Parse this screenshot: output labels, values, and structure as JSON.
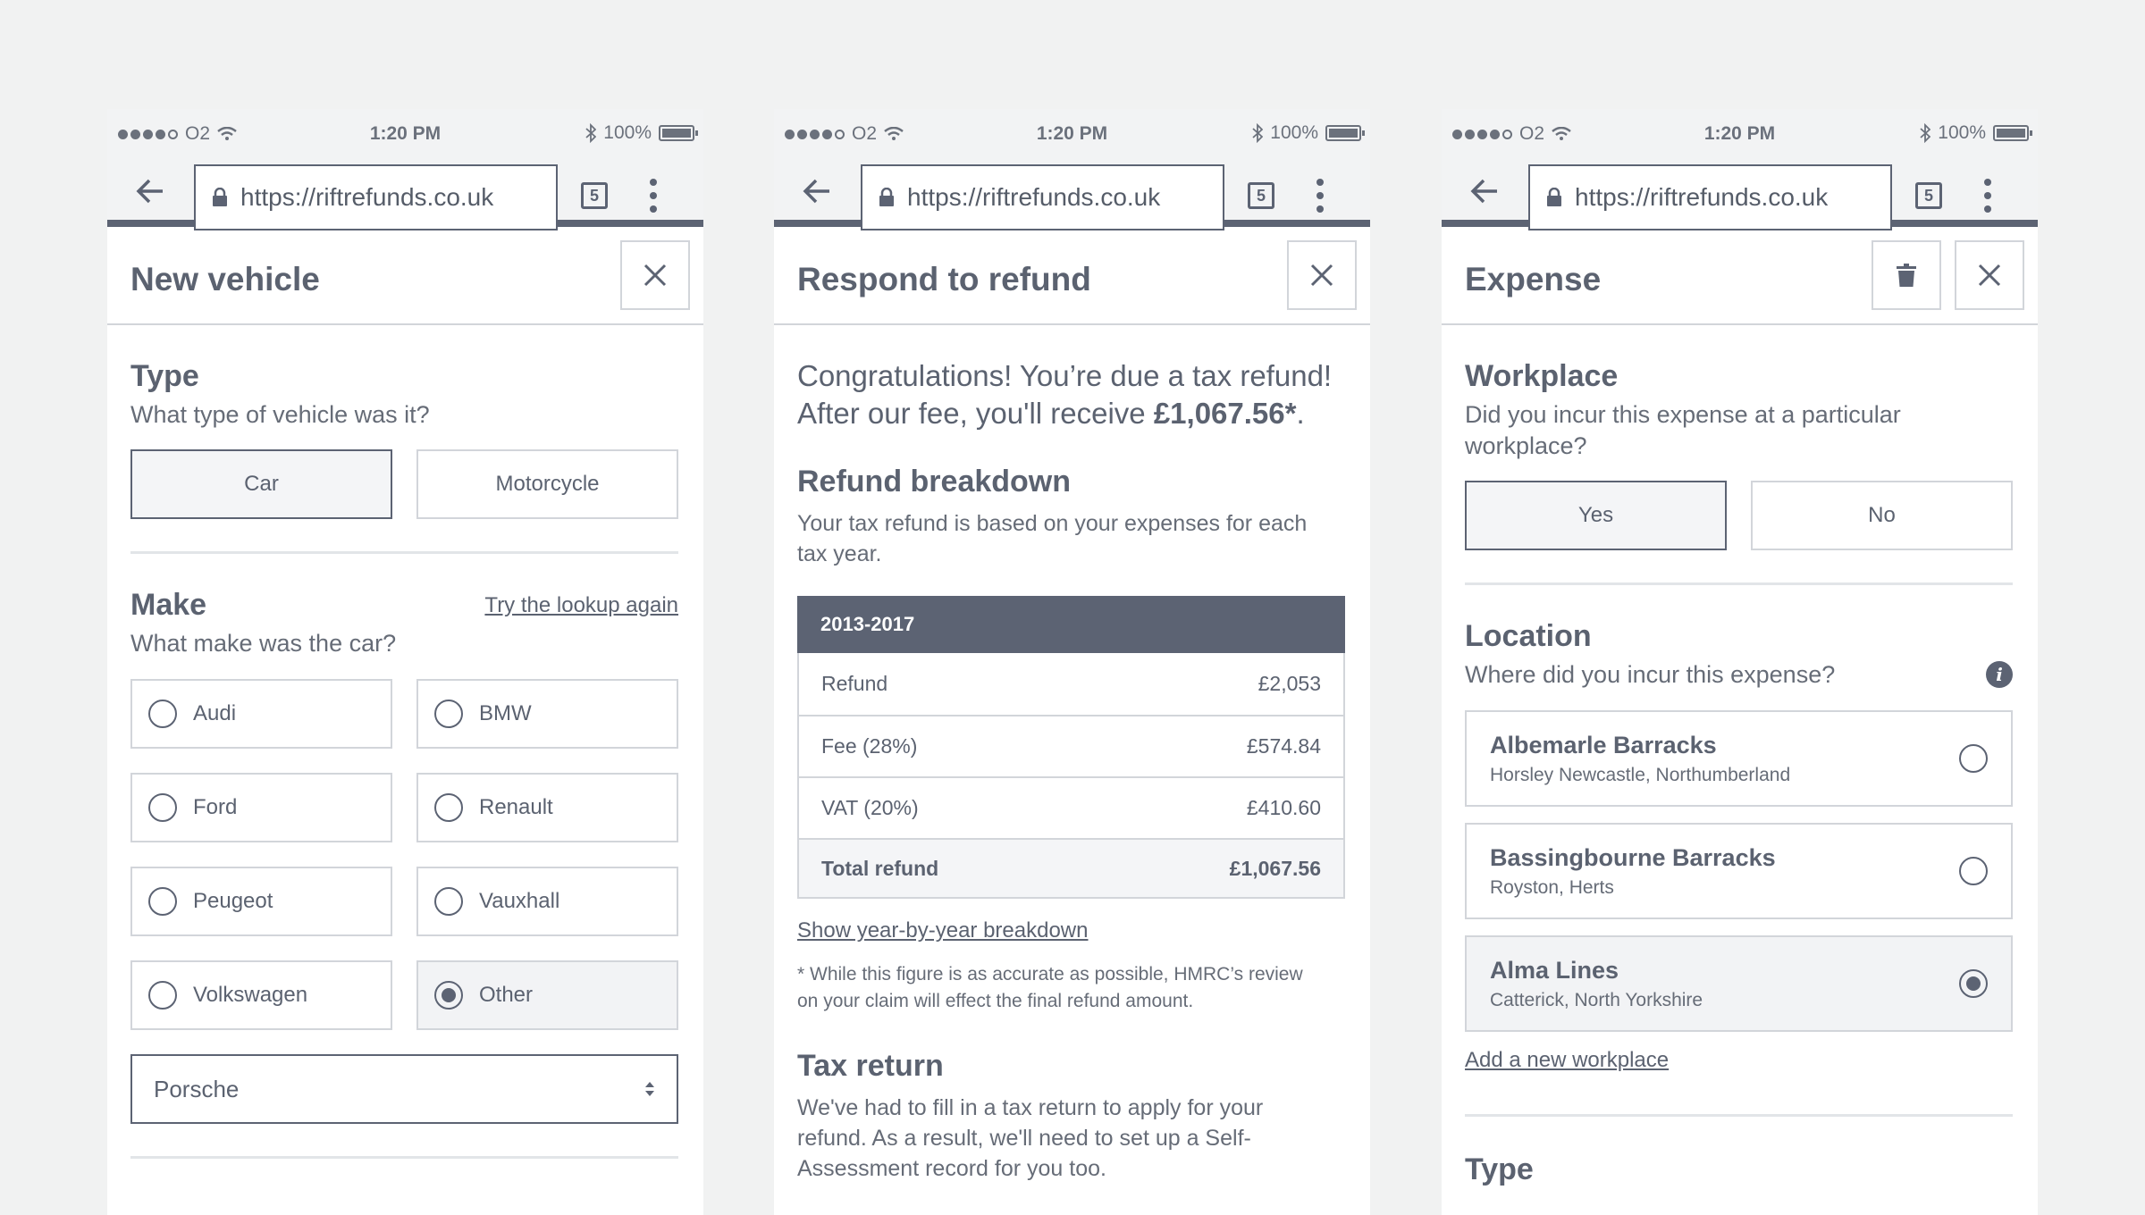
{
  "status_bar": {
    "carrier": "O2",
    "time": "1:20 PM",
    "battery": "100%"
  },
  "browser": {
    "url": "https://riftrefunds.co.uk",
    "tab_count": "5"
  },
  "screens": {
    "new_vehicle": {
      "title": "New vehicle",
      "type": {
        "heading": "Type",
        "question": "What type of vehicle was it?",
        "options": [
          "Car",
          "Motorcycle"
        ],
        "selected": "Car"
      },
      "make": {
        "heading": "Make",
        "lookup_link": "Try the lookup again",
        "question": "What make was the car?",
        "options": [
          "Audi",
          "BMW",
          "Ford",
          "Renault",
          "Peugeot",
          "Vauxhall",
          "Volkswagen",
          "Other"
        ],
        "selected": "Other",
        "other_value": "Porsche"
      }
    },
    "refund": {
      "title": "Respond to refund",
      "intro_1": "Congratulations! You’re due a tax refund!",
      "intro_2_prefix": "After our fee, you'll receive ",
      "intro_2_amount": "£1,067.56*",
      "intro_2_suffix": ".",
      "breakdown": {
        "heading": "Refund breakdown",
        "description_1": "Your tax refund is based on your expenses for each",
        "description_2": "tax year.",
        "period": "2013-2017",
        "rows": [
          {
            "label": "Refund",
            "value": "£2,053"
          },
          {
            "label": "Fee (28%)",
            "value": "£574.84"
          },
          {
            "label": "VAT (20%)",
            "value": "£410.60"
          }
        ],
        "total": {
          "label": "Total refund",
          "value": "£1,067.56"
        }
      },
      "year_link": "Show year-by-year breakdown",
      "footnote_1": "* While this figure is as accurate as possible, HMRC’s review",
      "footnote_2": "on your claim will effect the final refund amount.",
      "tax_return": {
        "heading": "Tax return",
        "line_1": "We've had to fill in a tax return to apply for your",
        "line_2": "refund. As a result, we'll need to set up a Self-",
        "line_3": "Assessment record for you too."
      }
    },
    "expense": {
      "title": "Expense",
      "workplace": {
        "heading": "Workplace",
        "question_1": "Did you incur this expense at a particular",
        "question_2": "workplace?",
        "options": [
          "Yes",
          "No"
        ],
        "selected": "Yes"
      },
      "location": {
        "heading": "Location",
        "question": "Where did you incur this expense?",
        "info_glyph": "i",
        "places": [
          {
            "name": "Albemarle Barracks",
            "address": "Horsley Newcastle, Northumberland"
          },
          {
            "name": "Bassingbourne Barracks",
            "address": "Royston, Herts"
          },
          {
            "name": "Alma Lines",
            "address": "Catterick, North Yorkshire"
          }
        ],
        "selected": "Alma Lines",
        "add_link": "Add a new workplace"
      },
      "type_heading": "Type"
    }
  },
  "colors": {
    "primary": "#5c6373",
    "border": "#d2d5da",
    "background": "#f1f2f2",
    "text": "#5b6270"
  },
  "icons": [
    "back-arrow-icon",
    "lock-icon",
    "tabs-icon",
    "more-vert-icon",
    "close-icon",
    "trash-icon",
    "wifi-icon",
    "bluetooth-icon",
    "battery-icon",
    "info-icon",
    "select-arrows-icon"
  ]
}
